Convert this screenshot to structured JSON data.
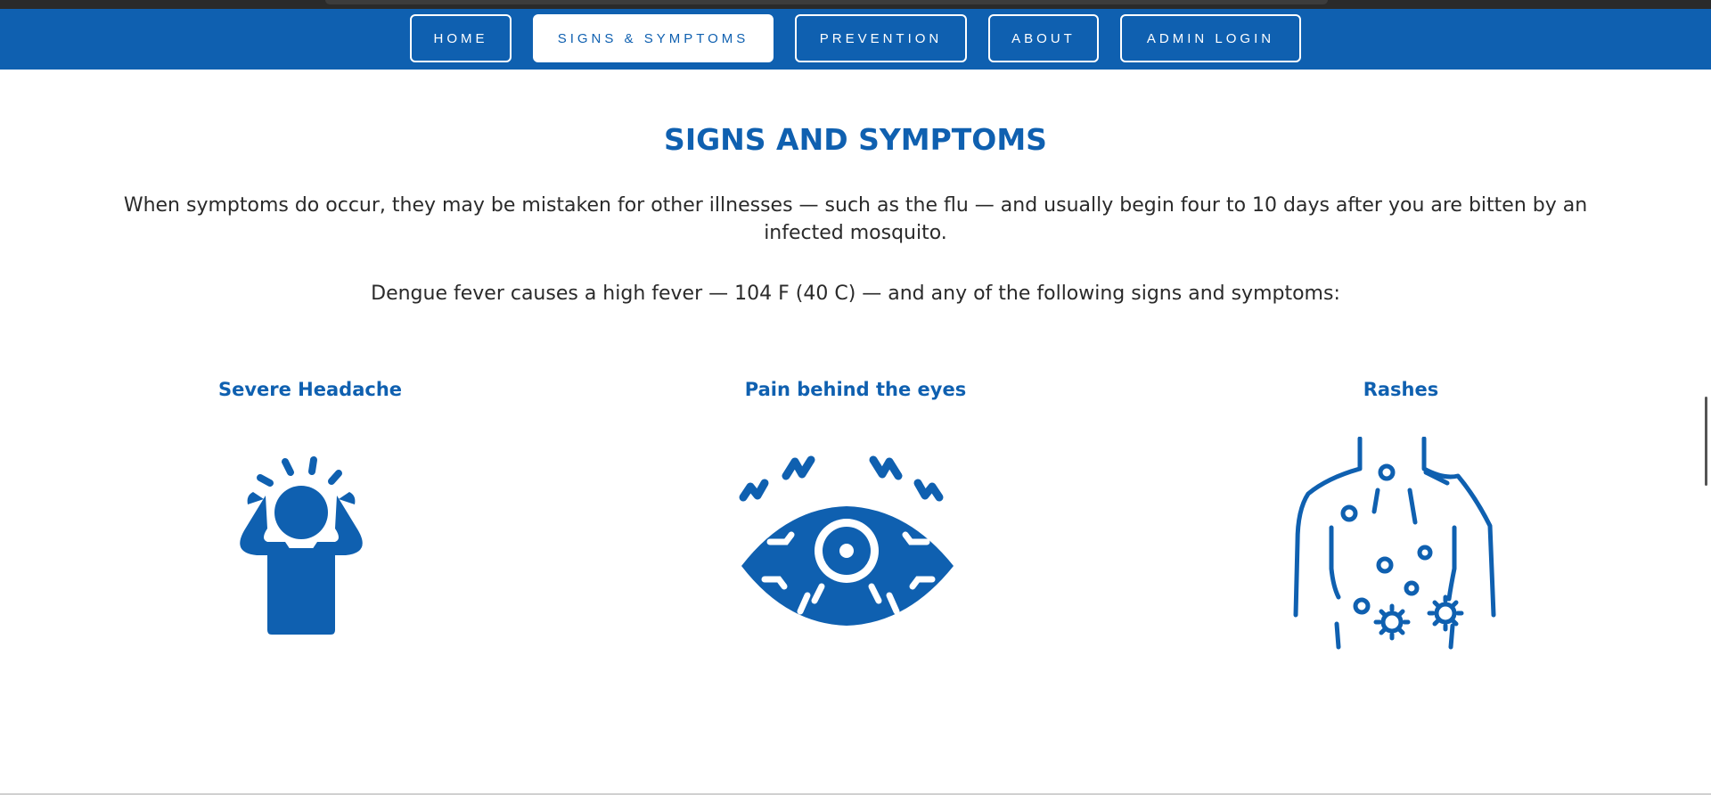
{
  "nav": {
    "items": [
      {
        "label": "HOME",
        "active": false
      },
      {
        "label": "SIGNS & SYMPTOMS",
        "active": true
      },
      {
        "label": "PREVENTION",
        "active": false
      },
      {
        "label": "ABOUT",
        "active": false
      },
      {
        "label": "ADMIN LOGIN",
        "active": false
      }
    ]
  },
  "main": {
    "heading": "SIGNS AND SYMPTOMS",
    "paragraph1": "When symptoms do occur, they may be mistaken for other illnesses — such as the flu — and usually begin four to 10 days after you are bitten by an infected mosquito.",
    "paragraph2": "Dengue fever causes a high fever — 104 F (40 C) — and any of the following signs and symptoms:",
    "symptoms": [
      {
        "title": "Severe Headache",
        "icon": "headache-icon"
      },
      {
        "title": "Pain behind the eyes",
        "icon": "eye-pain-icon"
      },
      {
        "title": "Rashes",
        "icon": "rash-icon"
      }
    ]
  },
  "colors": {
    "brand_blue": "#0f60b0",
    "text": "#2a2a2a",
    "background": "#ffffff"
  }
}
